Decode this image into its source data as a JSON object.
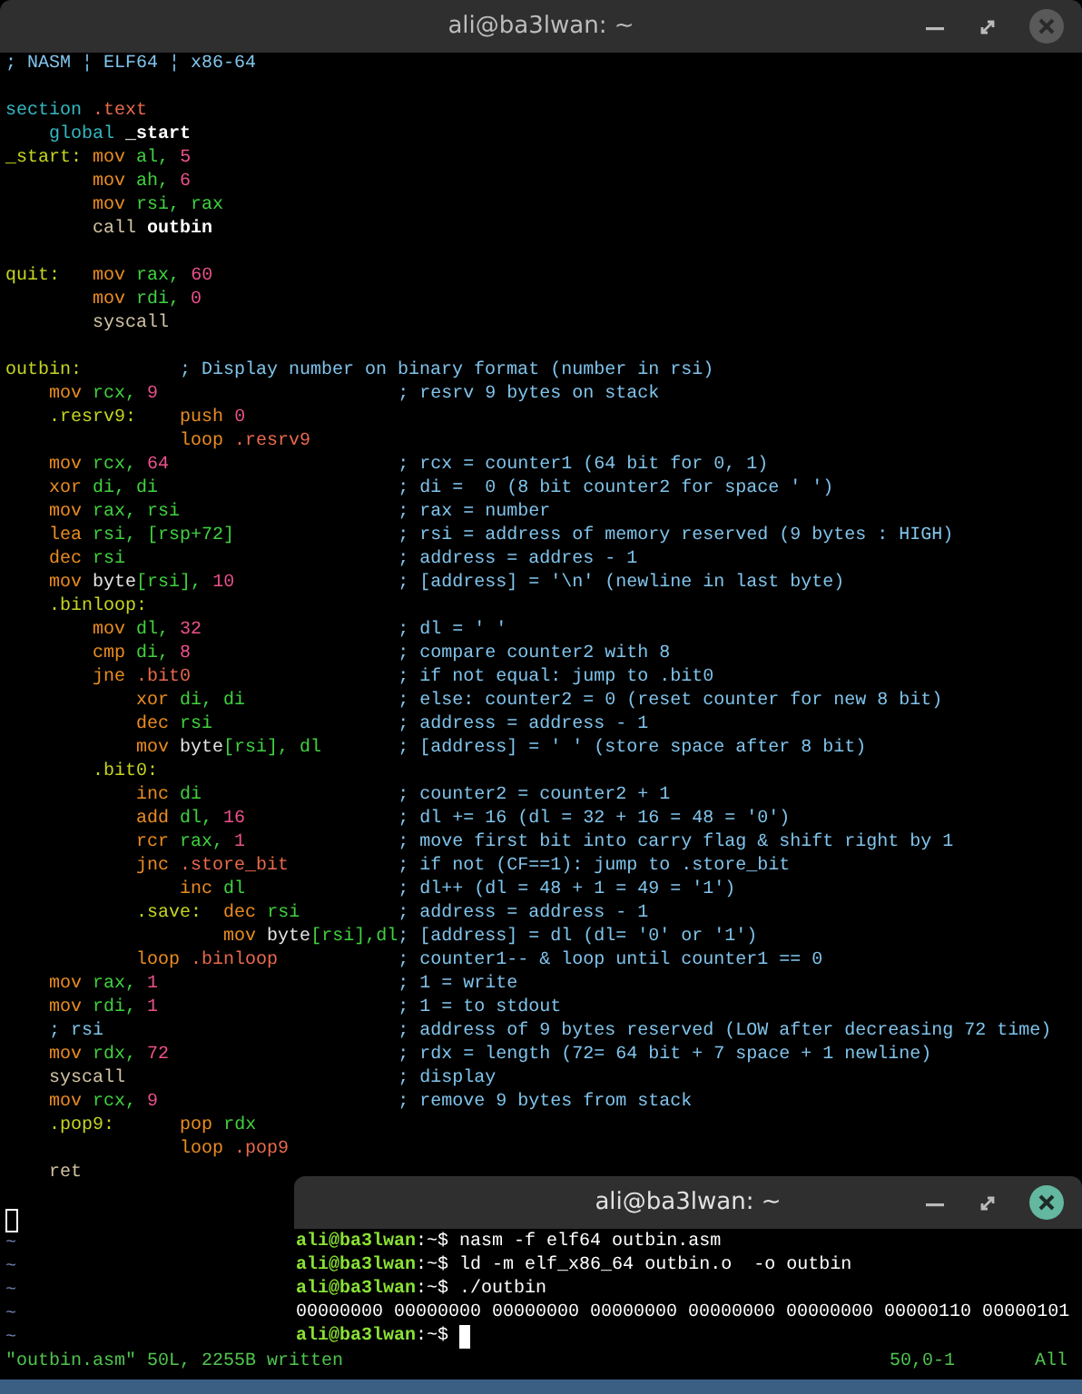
{
  "editor_window": {
    "title": "ali@ba3lwan: ~",
    "lines": [
      {
        "segments": [
          {
            "kind": "comment",
            "text": "; NASM ¦ ELF64 ¦ x86-64"
          }
        ]
      },
      {
        "kind": "blank"
      },
      {
        "segments": [
          {
            "kind": "directive",
            "text": "section "
          },
          {
            "kind": "ref",
            "text": ".text"
          }
        ]
      },
      {
        "segments": [
          {
            "kind": "directive",
            "text": "    global "
          },
          {
            "kind": "bold",
            "text": "_start"
          }
        ]
      },
      {
        "segments": [
          {
            "kind": "label",
            "text": "_start: "
          },
          {
            "kind": "instr",
            "text": "mov "
          },
          {
            "kind": "reg",
            "text": "al, "
          },
          {
            "kind": "num",
            "text": "5"
          }
        ]
      },
      {
        "segments": [
          {
            "kind": "instr",
            "text": "        mov "
          },
          {
            "kind": "reg",
            "text": "ah, "
          },
          {
            "kind": "num",
            "text": "6"
          }
        ]
      },
      {
        "segments": [
          {
            "kind": "instr",
            "text": "        mov "
          },
          {
            "kind": "reg",
            "text": "rsi, rax"
          }
        ]
      },
      {
        "segments": [
          {
            "kind": "call",
            "text": "        call "
          },
          {
            "kind": "bold",
            "text": "outbin"
          }
        ]
      },
      {
        "kind": "blank"
      },
      {
        "segments": [
          {
            "kind": "label",
            "text": "quit:   "
          },
          {
            "kind": "instr",
            "text": "mov "
          },
          {
            "kind": "reg",
            "text": "rax, "
          },
          {
            "kind": "num",
            "text": "60"
          }
        ]
      },
      {
        "segments": [
          {
            "kind": "instr",
            "text": "        mov "
          },
          {
            "kind": "reg",
            "text": "rdi, "
          },
          {
            "kind": "num",
            "text": "0"
          }
        ]
      },
      {
        "segments": [
          {
            "kind": "call",
            "text": "        syscall"
          }
        ]
      },
      {
        "kind": "blank"
      },
      {
        "segments": [
          {
            "kind": "label",
            "text": "outbin:         "
          },
          {
            "kind": "comment",
            "text": "; Display number on binary format (number in rsi)"
          }
        ]
      },
      {
        "segments": [
          {
            "kind": "instr",
            "text": "    mov "
          },
          {
            "kind": "reg",
            "text": "rcx, "
          },
          {
            "kind": "num",
            "text": "9                      "
          },
          {
            "kind": "comment",
            "text": "; resrv 9 bytes on stack"
          }
        ]
      },
      {
        "segments": [
          {
            "kind": "label",
            "text": "    .resrv9:    "
          },
          {
            "kind": "instr",
            "text": "push "
          },
          {
            "kind": "num",
            "text": "0"
          }
        ]
      },
      {
        "segments": [
          {
            "kind": "instr",
            "text": "                loop "
          },
          {
            "kind": "ref",
            "text": ".resrv9"
          }
        ]
      },
      {
        "segments": [
          {
            "kind": "instr",
            "text": "    mov "
          },
          {
            "kind": "reg",
            "text": "rcx, "
          },
          {
            "kind": "num",
            "text": "64                     "
          },
          {
            "kind": "comment",
            "text": "; rcx = counter1 (64 bit for 0, 1)"
          }
        ]
      },
      {
        "segments": [
          {
            "kind": "instr",
            "text": "    xor "
          },
          {
            "kind": "reg",
            "text": "di, di                      "
          },
          {
            "kind": "comment",
            "text": "; di =  0 (8 bit counter2 for space ' ')"
          }
        ]
      },
      {
        "segments": [
          {
            "kind": "instr",
            "text": "    mov "
          },
          {
            "kind": "reg",
            "text": "rax, rsi                    "
          },
          {
            "kind": "comment",
            "text": "; rax = number"
          }
        ]
      },
      {
        "segments": [
          {
            "kind": "instr",
            "text": "    lea "
          },
          {
            "kind": "reg",
            "text": "rsi, [rsp+72]               "
          },
          {
            "kind": "comment",
            "text": "; rsi = address of memory reserved (9 bytes : HIGH)"
          }
        ]
      },
      {
        "segments": [
          {
            "kind": "instr",
            "text": "    dec "
          },
          {
            "kind": "reg",
            "text": "rsi                         "
          },
          {
            "kind": "comment",
            "text": "; address = addres - 1"
          }
        ]
      },
      {
        "segments": [
          {
            "kind": "instr",
            "text": "    mov "
          },
          {
            "kind": "plain",
            "text": "byte"
          },
          {
            "kind": "reg",
            "text": "[rsi], "
          },
          {
            "kind": "num",
            "text": "10               "
          },
          {
            "kind": "comment",
            "text": "; [address] = '\\n' (newline in last byte)"
          }
        ]
      },
      {
        "segments": [
          {
            "kind": "label",
            "text": "    .binloop:"
          }
        ]
      },
      {
        "segments": [
          {
            "kind": "instr",
            "text": "        mov "
          },
          {
            "kind": "reg",
            "text": "dl, "
          },
          {
            "kind": "num",
            "text": "32                  "
          },
          {
            "kind": "comment",
            "text": "; dl = ' '"
          }
        ]
      },
      {
        "segments": [
          {
            "kind": "instr",
            "text": "        cmp "
          },
          {
            "kind": "reg",
            "text": "di, "
          },
          {
            "kind": "num",
            "text": "8                   "
          },
          {
            "kind": "comment",
            "text": "; compare counter2 with 8"
          }
        ]
      },
      {
        "segments": [
          {
            "kind": "instr",
            "text": "        jne "
          },
          {
            "kind": "ref",
            "text": ".bit0                   "
          },
          {
            "kind": "comment",
            "text": "; if not equal: jump to .bit0"
          }
        ]
      },
      {
        "segments": [
          {
            "kind": "instr",
            "text": "            xor "
          },
          {
            "kind": "reg",
            "text": "di, di              "
          },
          {
            "kind": "comment",
            "text": "; else: counter2 = 0 (reset counter for new 8 bit)"
          }
        ]
      },
      {
        "segments": [
          {
            "kind": "instr",
            "text": "            dec "
          },
          {
            "kind": "reg",
            "text": "rsi                 "
          },
          {
            "kind": "comment",
            "text": "; address = address - 1"
          }
        ]
      },
      {
        "segments": [
          {
            "kind": "instr",
            "text": "            mov "
          },
          {
            "kind": "plain",
            "text": "byte"
          },
          {
            "kind": "reg",
            "text": "[rsi], dl       "
          },
          {
            "kind": "comment",
            "text": "; [address] = ' ' (store space after 8 bit)"
          }
        ]
      },
      {
        "segments": [
          {
            "kind": "label",
            "text": "        .bit0:"
          }
        ]
      },
      {
        "segments": [
          {
            "kind": "instr",
            "text": "            inc "
          },
          {
            "kind": "reg",
            "text": "di                  "
          },
          {
            "kind": "comment",
            "text": "; counter2 = counter2 + 1"
          }
        ]
      },
      {
        "segments": [
          {
            "kind": "instr",
            "text": "            add "
          },
          {
            "kind": "reg",
            "text": "dl, "
          },
          {
            "kind": "num",
            "text": "16              "
          },
          {
            "kind": "comment",
            "text": "; dl += 16 (dl = 32 + 16 = 48 = '0')"
          }
        ]
      },
      {
        "segments": [
          {
            "kind": "instr",
            "text": "            rcr "
          },
          {
            "kind": "reg",
            "text": "rax, "
          },
          {
            "kind": "num",
            "text": "1              "
          },
          {
            "kind": "comment",
            "text": "; move first bit into carry flag & shift right by 1"
          }
        ]
      },
      {
        "segments": [
          {
            "kind": "instr",
            "text": "            jnc "
          },
          {
            "kind": "ref",
            "text": ".store_bit          "
          },
          {
            "kind": "comment",
            "text": "; if not (CF==1): jump to .store_bit"
          }
        ]
      },
      {
        "segments": [
          {
            "kind": "instr",
            "text": "                inc "
          },
          {
            "kind": "reg",
            "text": "dl              "
          },
          {
            "kind": "comment",
            "text": "; dl++ (dl = 48 + 1 = 49 = '1')"
          }
        ]
      },
      {
        "segments": [
          {
            "kind": "label",
            "text": "            .save:  "
          },
          {
            "kind": "instr",
            "text": "dec "
          },
          {
            "kind": "reg",
            "text": "rsi         "
          },
          {
            "kind": "comment",
            "text": "; address = address - 1"
          }
        ]
      },
      {
        "segments": [
          {
            "kind": "instr",
            "text": "                    mov "
          },
          {
            "kind": "plain",
            "text": "byte"
          },
          {
            "kind": "reg",
            "text": "[rsi],dl"
          },
          {
            "kind": "comment",
            "text": "; [address] = dl (dl= '0' or '1')"
          }
        ]
      },
      {
        "segments": [
          {
            "kind": "instr",
            "text": "            loop "
          },
          {
            "kind": "ref",
            "text": ".binloop           "
          },
          {
            "kind": "comment",
            "text": "; counter1-- & loop until counter1 == 0"
          }
        ]
      },
      {
        "segments": [
          {
            "kind": "instr",
            "text": "    mov "
          },
          {
            "kind": "reg",
            "text": "rax, "
          },
          {
            "kind": "num",
            "text": "1                      "
          },
          {
            "kind": "comment",
            "text": "; 1 = write"
          }
        ]
      },
      {
        "segments": [
          {
            "kind": "instr",
            "text": "    mov "
          },
          {
            "kind": "reg",
            "text": "rdi, "
          },
          {
            "kind": "num",
            "text": "1                      "
          },
          {
            "kind": "comment",
            "text": "; 1 = to stdout"
          }
        ]
      },
      {
        "segments": [
          {
            "kind": "comment",
            "text": "    ; rsi                           "
          },
          {
            "kind": "comment",
            "text": "; address of 9 bytes reserved (LOW after decreasing 72 time)"
          }
        ]
      },
      {
        "segments": [
          {
            "kind": "instr",
            "text": "    mov "
          },
          {
            "kind": "reg",
            "text": "rdx, "
          },
          {
            "kind": "num",
            "text": "72                     "
          },
          {
            "kind": "comment",
            "text": "; rdx = length (72= 64 bit + 7 space + 1 newline)"
          }
        ]
      },
      {
        "segments": [
          {
            "kind": "call",
            "text": "    syscall                         "
          },
          {
            "kind": "comment",
            "text": "; display"
          }
        ]
      },
      {
        "segments": [
          {
            "kind": "instr",
            "text": "    mov "
          },
          {
            "kind": "reg",
            "text": "rcx, "
          },
          {
            "kind": "num",
            "text": "9                      "
          },
          {
            "kind": "comment",
            "text": "; remove 9 bytes from stack"
          }
        ]
      },
      {
        "segments": [
          {
            "kind": "label",
            "text": "    .pop9:      "
          },
          {
            "kind": "instr",
            "text": "pop "
          },
          {
            "kind": "reg",
            "text": "rdx"
          }
        ]
      },
      {
        "segments": [
          {
            "kind": "instr",
            "text": "                loop "
          },
          {
            "kind": "ref",
            "text": ".pop9"
          }
        ]
      },
      {
        "segments": [
          {
            "kind": "call",
            "text": "    ret"
          }
        ]
      },
      {
        "kind": "blank"
      },
      {
        "kind": "cursor"
      }
    ],
    "tildes": [
      "~",
      "~",
      "~",
      "~",
      "~"
    ],
    "status": {
      "message": "\"outbin.asm\" 50L, 2255B written",
      "position": "50,0-1",
      "scroll": "All"
    }
  },
  "terminal_window": {
    "title": "ali@ba3lwan: ~",
    "lines": [
      {
        "kind": "prompt",
        "user": "ali@ba3lwan",
        "path": ":~$",
        "command": "nasm -f elf64 outbin.asm"
      },
      {
        "kind": "prompt",
        "user": "ali@ba3lwan",
        "path": ":~$",
        "command": "ld -m elf_x86_64 outbin.o  -o outbin"
      },
      {
        "kind": "prompt",
        "user": "ali@ba3lwan",
        "path": ":~$",
        "command": "./outbin"
      },
      {
        "kind": "output",
        "text": "00000000 00000000 00000000 00000000 00000000 00000000 00000110 00000101"
      },
      {
        "kind": "prompt",
        "user": "ali@ba3lwan",
        "path": ":~$",
        "cursor": true
      }
    ]
  }
}
